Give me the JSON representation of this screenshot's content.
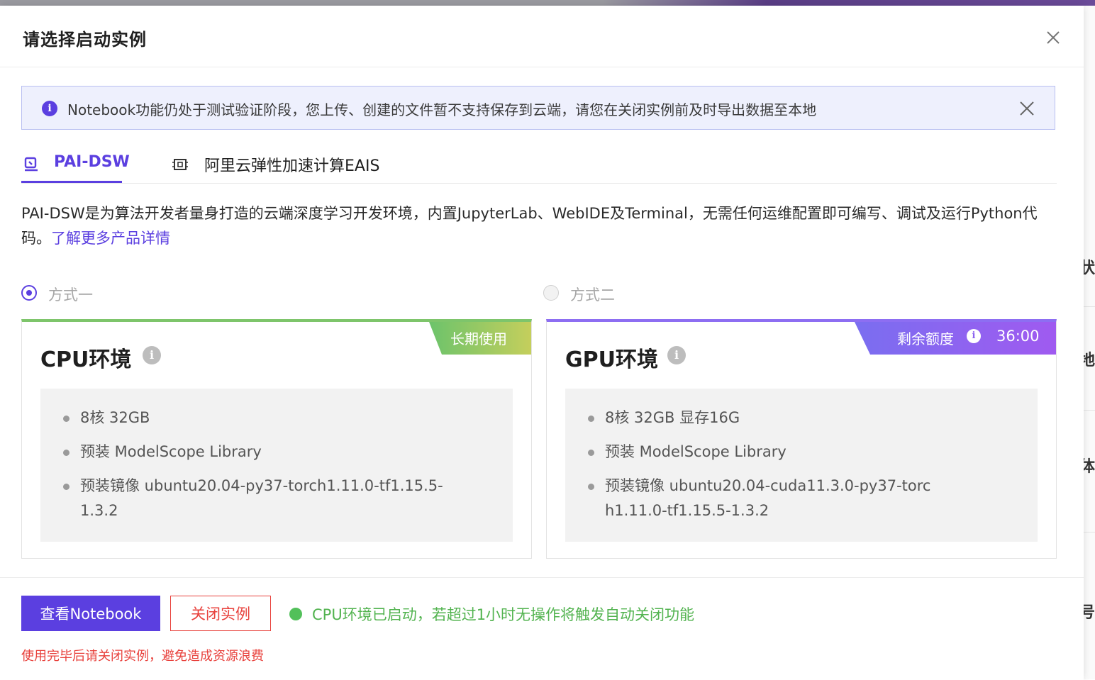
{
  "modal": {
    "title": "请选择启动实例"
  },
  "notice": {
    "text": "Notebook功能仍处于测试验证阶段，您上传、创建的文件暂不支持保存到云端，请您在关闭实例前及时导出数据至本地"
  },
  "tabs": [
    {
      "label": "PAI-DSW",
      "icon": "dsw-icon",
      "active": true
    },
    {
      "label": "阿里云弹性加速计算EAIS",
      "icon": "eais-chip-icon",
      "active": false
    }
  ],
  "description": {
    "text": "PAI-DSW是为算法开发者量身打造的云端深度学习开发环境，内置JupyterLab、WebIDE及Terminal，无需任何运维配置即可编写、调试及运行Python代码。",
    "link": "了解更多产品详情"
  },
  "options": [
    {
      "label": "方式一",
      "selected": true
    },
    {
      "label": "方式二",
      "selected": false
    }
  ],
  "cpu_card": {
    "title": "CPU环境",
    "badge": "长期使用",
    "specs": [
      "8核 32GB",
      "预装 ModelScope Library",
      "预装镜像 ubuntu20.04-py37-torch1.11.0-tf1.15.5-1.3.2"
    ]
  },
  "gpu_card": {
    "title": "GPU环境",
    "badge_label": "剩余额度",
    "badge_time": "36:00",
    "specs": [
      "8核 32GB 显存16G",
      "预装 ModelScope Library",
      "预装镜像 ubuntu20.04-cuda11.3.0-py37-torch1.11.0-tf1.15.5-1.3.2"
    ]
  },
  "footer": {
    "primary_button": "查看Notebook",
    "close_button": "关闭实例",
    "status": "CPU环境已启动，若超过1小时无操作将触发自动关闭功能",
    "warning": "使用完毕后请关闭实例，避免造成资源浪费"
  },
  "colors": {
    "accent": "#5b3fe0",
    "success": "#52c05a",
    "danger": "#e8413c"
  }
}
